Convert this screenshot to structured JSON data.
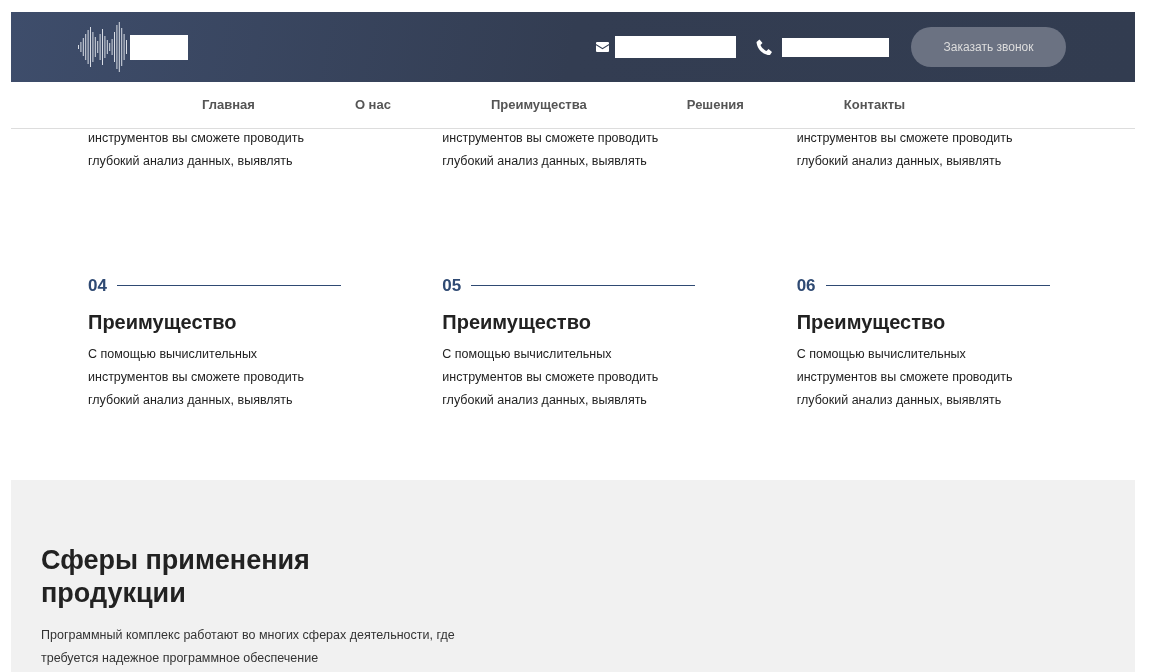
{
  "header": {
    "button": "Заказать звонок"
  },
  "nav": [
    {
      "label": "Главная"
    },
    {
      "label": "О нас"
    },
    {
      "label": "Преимущества"
    },
    {
      "label": "Решения"
    },
    {
      "label": "Контакты"
    }
  ],
  "partial_items": [
    {
      "text": "инструментов вы сможете проводить глубокий анализ данных, выявлять"
    },
    {
      "text": "инструментов вы сможете проводить глубокий анализ данных, выявлять"
    },
    {
      "text": "инструментов вы сможете проводить глубокий анализ данных, выявлять"
    }
  ],
  "advantages": [
    {
      "number": "04",
      "title": "Преимущество",
      "text": "С помощью вычислительных инструментов вы сможете проводить глубокий анализ данных, выявлять"
    },
    {
      "number": "05",
      "title": "Преимущество",
      "text": "С помощью вычислительных инструментов вы сможете проводить глубокий анализ данных, выявлять"
    },
    {
      "number": "06",
      "title": "Преимущество",
      "text": "С помощью вычислительных инструментов вы сможете проводить глубокий анализ данных, выявлять"
    }
  ],
  "spheres": {
    "title": "Сферы применения продукции",
    "text": "Программный комплекс работают во многих сферах деятельности, где требуется надежное программное обеспечение"
  }
}
